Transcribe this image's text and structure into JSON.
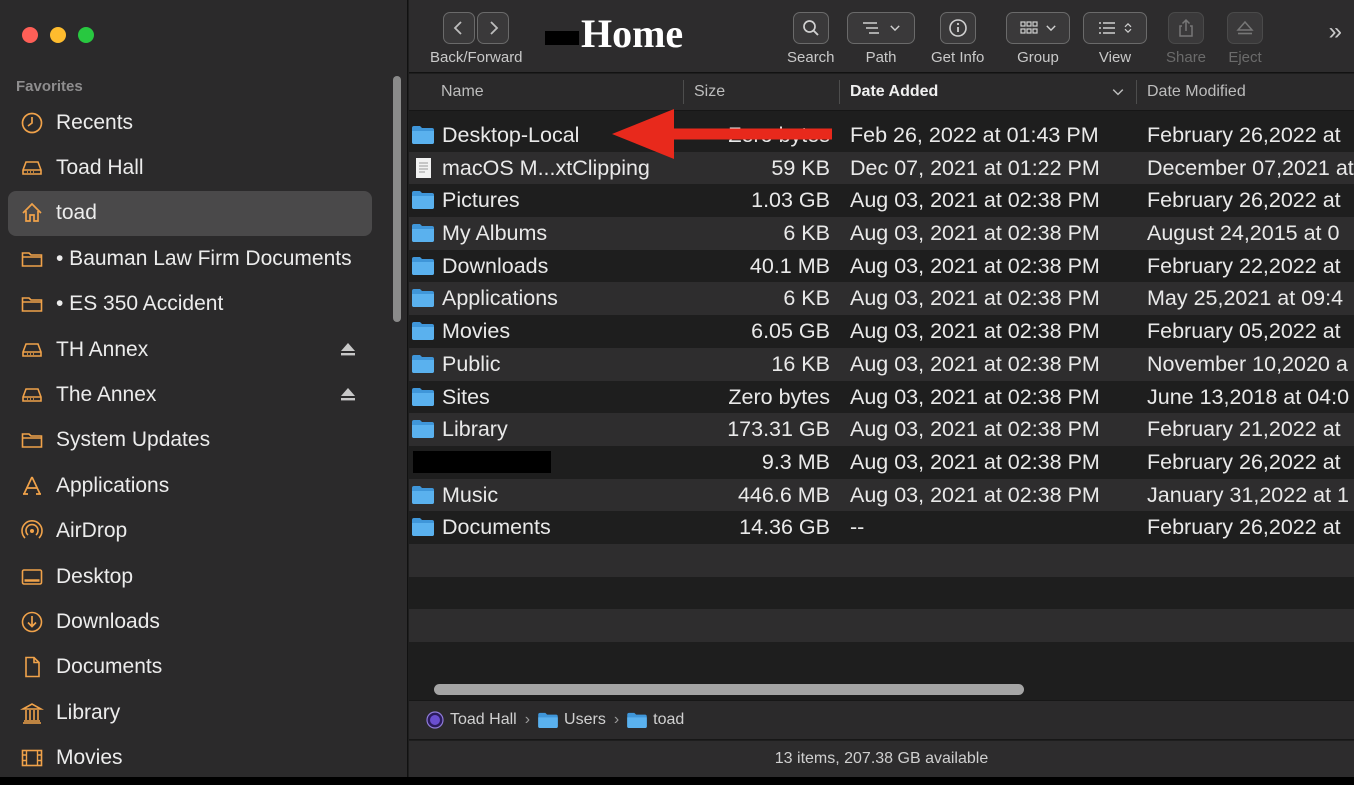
{
  "window": {
    "title": "Home",
    "traffic_lights": [
      "close",
      "minimize",
      "zoom"
    ]
  },
  "sidebar": {
    "section_label": "Favorites",
    "items": [
      {
        "label": "Recents",
        "icon": "clock-icon"
      },
      {
        "label": "Toad Hall",
        "icon": "drive-icon"
      },
      {
        "label": "toad",
        "icon": "home-icon",
        "selected": true
      },
      {
        "label": "• Bauman Law Firm Documents",
        "icon": "folder-icon"
      },
      {
        "label": "• ES 350 Accident",
        "icon": "folder-icon"
      },
      {
        "label": "TH Annex",
        "icon": "drive-icon",
        "ejectable": true
      },
      {
        "label": "The Annex",
        "icon": "drive-icon",
        "ejectable": true
      },
      {
        "label": "System Updates",
        "icon": "folder-icon"
      },
      {
        "label": "Applications",
        "icon": "applications-icon"
      },
      {
        "label": "AirDrop",
        "icon": "airdrop-icon"
      },
      {
        "label": "Desktop",
        "icon": "desktop-icon"
      },
      {
        "label": "Downloads",
        "icon": "download-icon"
      },
      {
        "label": "Documents",
        "icon": "document-icon"
      },
      {
        "label": "Library",
        "icon": "library-icon"
      },
      {
        "label": "Movies",
        "icon": "film-icon"
      }
    ]
  },
  "toolbar": {
    "back_forward_label": "Back/Forward",
    "search_label": "Search",
    "path_label": "Path",
    "get_info_label": "Get Info",
    "group_label": "Group",
    "view_label": "View",
    "share_label": "Share",
    "eject_label": "Eject",
    "more_glyph": "»"
  },
  "columns": {
    "name": "Name",
    "size": "Size",
    "date_added": "Date Added",
    "date_modified": "Date Modified",
    "sorted_by": "date_added"
  },
  "files": [
    {
      "name": "Desktop-Local",
      "size": "Zero bytes",
      "added": "Feb 26, 2022 at 01:43 PM",
      "modified": "February 26,2022 at",
      "icon": "folder-icon"
    },
    {
      "name": "macOS M...xtClipping",
      "size": "59 KB",
      "added": "Dec 07, 2021 at 01:22 PM",
      "modified": "December 07,2021 at",
      "icon": "text-clipping-icon"
    },
    {
      "name": "Pictures",
      "size": "1.03 GB",
      "added": "Aug 03, 2021 at 02:38 PM",
      "modified": "February 26,2022 at",
      "icon": "folder-icon"
    },
    {
      "name": "My Albums",
      "size": "6 KB",
      "added": "Aug 03, 2021 at 02:38 PM",
      "modified": "August 24,2015 at 0",
      "icon": "folder-icon"
    },
    {
      "name": "Downloads",
      "size": "40.1 MB",
      "added": "Aug 03, 2021 at 02:38 PM",
      "modified": "February 22,2022 at",
      "icon": "folder-icon"
    },
    {
      "name": "Applications",
      "size": "6 KB",
      "added": "Aug 03, 2021 at 02:38 PM",
      "modified": "May 25,2021 at 09:4",
      "icon": "folder-icon"
    },
    {
      "name": "Movies",
      "size": "6.05 GB",
      "added": "Aug 03, 2021 at 02:38 PM",
      "modified": "February 05,2022 at",
      "icon": "folder-icon"
    },
    {
      "name": "Public",
      "size": "16 KB",
      "added": "Aug 03, 2021 at 02:38 PM",
      "modified": "November 10,2020 a",
      "icon": "folder-icon"
    },
    {
      "name": "Sites",
      "size": "Zero bytes",
      "added": "Aug 03, 2021 at 02:38 PM",
      "modified": "June 13,2018 at 04:0",
      "icon": "folder-icon"
    },
    {
      "name": "Library",
      "size": "173.31 GB",
      "added": "Aug 03, 2021 at 02:38 PM",
      "modified": "February 21,2022 at",
      "icon": "folder-icon"
    },
    {
      "name": "",
      "size": "9.3 MB",
      "added": "Aug 03, 2021 at 02:38 PM",
      "modified": "February 26,2022 at",
      "icon": "redacted",
      "redacted": true
    },
    {
      "name": "Music",
      "size": "446.6 MB",
      "added": "Aug 03, 2021 at 02:38 PM",
      "modified": "January 31,2022 at 1",
      "icon": "folder-icon"
    },
    {
      "name": "Documents",
      "size": "14.36 GB",
      "added": "--",
      "modified": "February 26,2022 at",
      "icon": "folder-icon"
    }
  ],
  "pathbar": {
    "segments": [
      "Toad Hall",
      "Users",
      "toad"
    ],
    "separator": "›"
  },
  "status": {
    "text": "13 items, 207.38 GB available"
  },
  "colors": {
    "folder_blue": "#4fa8e8",
    "sidebar_icon": "#f0a24a",
    "annotation_arrow": "#e8291c"
  }
}
